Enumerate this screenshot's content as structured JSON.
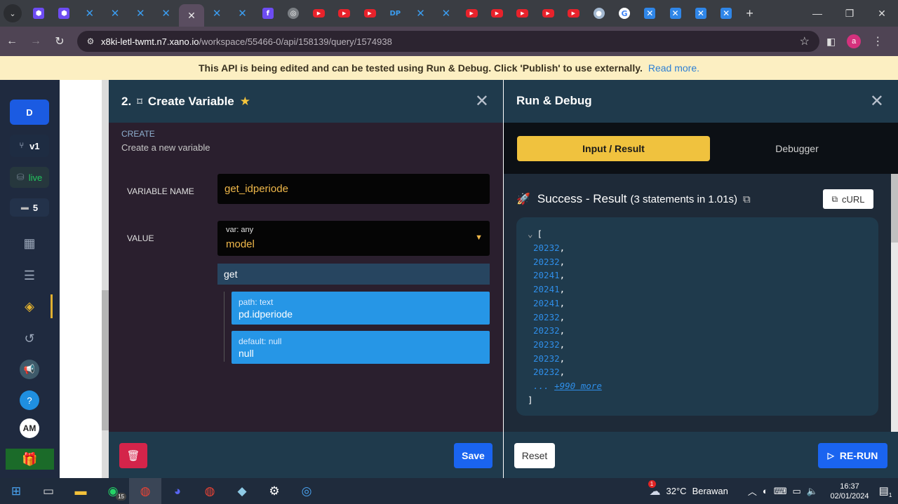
{
  "browser": {
    "tabs": [
      {
        "icon": "purple-cube-icon",
        "kind": "purple",
        "glyph": "⬢"
      },
      {
        "icon": "purple-cube-icon",
        "kind": "purple",
        "glyph": "⬢"
      },
      {
        "icon": "xano-icon",
        "kind": "xano",
        "glyph": "✕"
      },
      {
        "icon": "xano-icon",
        "kind": "xano",
        "glyph": "✕"
      },
      {
        "icon": "xano-icon",
        "kind": "xano",
        "glyph": "✕"
      },
      {
        "icon": "xano-icon",
        "kind": "xano",
        "glyph": "✕"
      },
      {
        "icon": "close-icon",
        "kind": "active",
        "glyph": "✕"
      },
      {
        "icon": "xano-icon",
        "kind": "xano",
        "glyph": "✕"
      },
      {
        "icon": "xano-icon",
        "kind": "xano",
        "glyph": "✕"
      },
      {
        "icon": "purple-app-icon",
        "kind": "purple",
        "glyph": "f"
      },
      {
        "icon": "chatgpt-icon",
        "kind": "gpt",
        "glyph": "◎"
      },
      {
        "icon": "youtube-icon",
        "kind": "yt",
        "glyph": "▶"
      },
      {
        "icon": "youtube-icon",
        "kind": "yt",
        "glyph": "▶"
      },
      {
        "icon": "youtube-icon",
        "kind": "yt",
        "glyph": "▶"
      },
      {
        "icon": "dp-icon",
        "kind": "dp",
        "glyph": "DP"
      },
      {
        "icon": "xano-icon",
        "kind": "xano",
        "glyph": "✕"
      },
      {
        "icon": "xano-icon",
        "kind": "xano",
        "glyph": "✕"
      },
      {
        "icon": "youtube-icon",
        "kind": "yt",
        "glyph": "▶"
      },
      {
        "icon": "youtube-icon",
        "kind": "yt",
        "glyph": "▶"
      },
      {
        "icon": "youtube-icon",
        "kind": "yt",
        "glyph": "▶"
      },
      {
        "icon": "youtube-icon",
        "kind": "yt",
        "glyph": "▶"
      },
      {
        "icon": "youtube-icon",
        "kind": "yt",
        "glyph": "▶"
      },
      {
        "icon": "ghost-icon",
        "kind": "ghost",
        "glyph": "●"
      },
      {
        "icon": "google-icon",
        "kind": "google",
        "glyph": "G"
      },
      {
        "icon": "xbox-icon",
        "kind": "xbox",
        "glyph": "✕"
      },
      {
        "icon": "xbox-icon",
        "kind": "xbox",
        "glyph": "✕"
      },
      {
        "icon": "xbox-icon",
        "kind": "xbox",
        "glyph": "✕"
      },
      {
        "icon": "xbox-icon",
        "kind": "xbox",
        "glyph": "✕"
      }
    ],
    "url_host": "x8ki-letl-twmt.n7.xano.io",
    "url_path": "/workspace/55466-0/api/158139/query/1574938",
    "profile_initial": "a"
  },
  "banner": {
    "text": "This API is being edited and can be tested using Run & Debug. Click 'Publish' to use externally.",
    "link": "Read more."
  },
  "rail": {
    "workspace_initial": "D",
    "version": "v1",
    "live": "live",
    "messages": "5",
    "user_initials": "AM"
  },
  "step": {
    "number": "2.",
    "title": "Create Variable",
    "category": "CREATE",
    "description": "Create a new variable",
    "variable_name_label": "VARIABLE NAME",
    "variable_name": "get_idperiode",
    "value_label": "VALUE",
    "value_type": "var: any",
    "value": "model",
    "filter": "get",
    "args": [
      {
        "hint": "path: text",
        "value": "pd.idperiode"
      },
      {
        "hint": "default: null",
        "value": "null"
      }
    ],
    "save_label": "Save"
  },
  "debug": {
    "title": "Run & Debug",
    "tabs": [
      "Input / Result",
      "Debugger"
    ],
    "status": "Success - Result",
    "status_detail": "(3 statements in 1.01s)",
    "curl_label": "cURL",
    "open_bracket": "[",
    "close_bracket": "]",
    "results": [
      "20232",
      "20232",
      "20241",
      "20241",
      "20241",
      "20232",
      "20232",
      "20232",
      "20232",
      "20232"
    ],
    "more_prefix": "...",
    "more_link": "+990 more",
    "reset_label": "Reset",
    "rerun_label": "RE-RUN"
  },
  "taskbar": {
    "whatsapp_badge": "15",
    "weather": "32°C",
    "weather_desc": "Berawan",
    "weather_alert": "1",
    "time": "16:37",
    "date": "02/01/2024",
    "notification_count": "1"
  }
}
